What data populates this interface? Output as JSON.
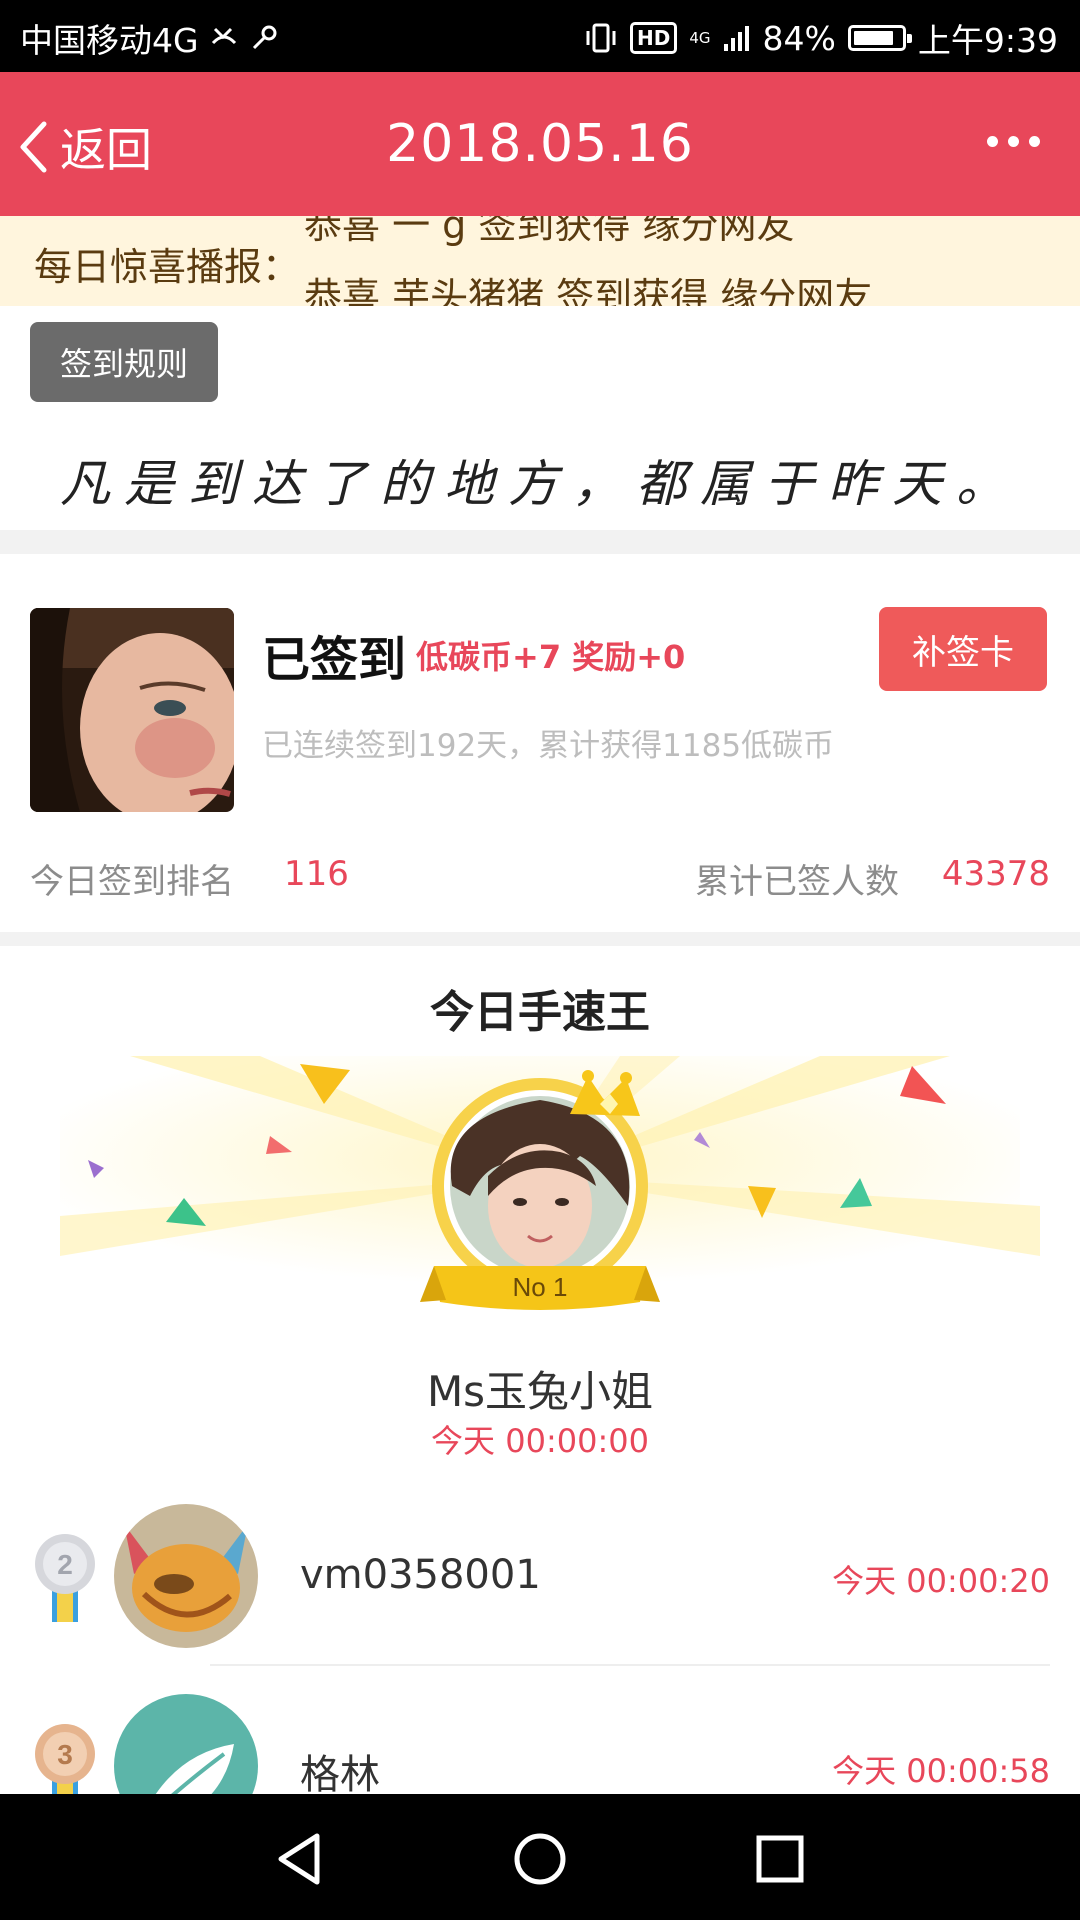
{
  "status_bar": {
    "carrier": "中国移动4G",
    "network": "4G",
    "hd": "HD",
    "battery_percent": "84%",
    "battery_level": 0.84,
    "time": "上午9:39"
  },
  "header": {
    "back_label": "返回",
    "title": "2018.05.16"
  },
  "broadcast": {
    "label": "每日惊喜播报：",
    "previous_item": "恭喜 一 g 签到获得 缘分网友",
    "current_item": "恭喜 芋头猪猪 签到获得 缘分网友"
  },
  "rules_button": "签到规则",
  "quote": "凡是到达了的地方，都属于昨天。",
  "signin": {
    "status": "已签到",
    "reward": "低碳币+7 奖励+0",
    "makeup_button": "补签卡",
    "streak_text": "已连续签到192天，累计获得1185低碳币",
    "rank_label": "今日签到排名",
    "rank_value": "116",
    "total_label": "累计已签人数",
    "total_value": "43378"
  },
  "speed_king": {
    "title": "今日手速王",
    "champion": {
      "badge": "No 1",
      "name": "Ms玉兔小姐",
      "time": "今天 00:00:00"
    },
    "runners": [
      {
        "rank": "2",
        "name": "vm0358001",
        "time": "今天 00:00:20"
      },
      {
        "rank": "3",
        "name": "格林",
        "time": "今天 00:00:58"
      }
    ]
  },
  "colors": {
    "header_red": "#e8475a",
    "accent_red": "#e8475a",
    "broadcast_bg": "#fff5dd",
    "crown_gold": "#f5c518"
  },
  "icons": {
    "back": "chevron-left-icon",
    "more": "more-dots-icon",
    "nav_back": "triangle-back-icon",
    "nav_home": "circle-home-icon",
    "nav_recent": "square-recent-icon"
  }
}
